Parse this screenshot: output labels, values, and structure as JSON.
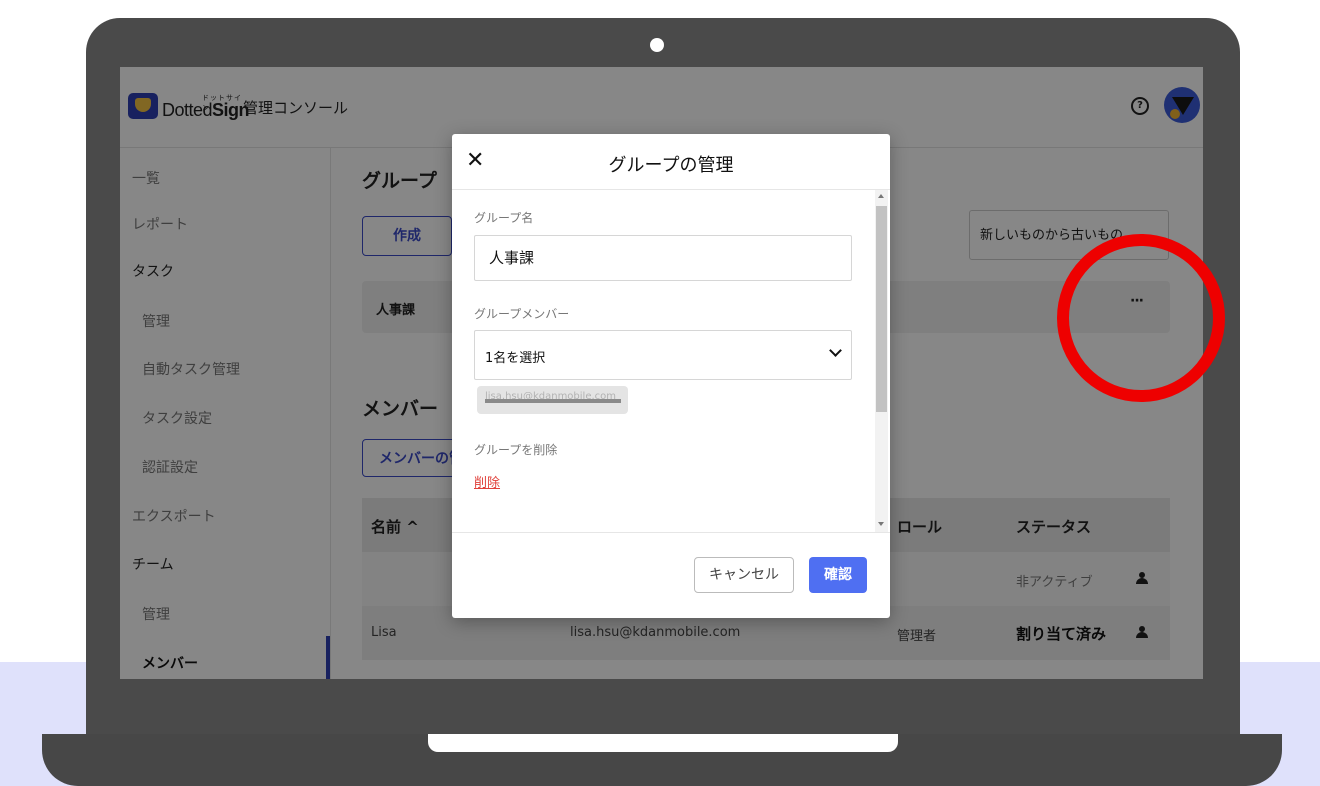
{
  "header": {
    "brand_sup": "ドットサイン",
    "brand_name_a": "Dotted",
    "brand_name_b": "Sign",
    "console_title": "管理コンソール"
  },
  "sidebar": {
    "items": [
      {
        "label": "一覧"
      },
      {
        "label": "レポート"
      },
      {
        "label": "タスク"
      },
      {
        "label": "管理"
      },
      {
        "label": "自動タスク管理"
      },
      {
        "label": "タスク設定"
      },
      {
        "label": "認証設定"
      },
      {
        "label": "エクスポート"
      },
      {
        "label": "チーム"
      },
      {
        "label": "管理"
      },
      {
        "label": "メンバー"
      }
    ]
  },
  "main": {
    "group_heading": "グループ",
    "create_button": "作成",
    "sort_value": "新しいものから古いもの",
    "group_rows": [
      {
        "name": "人事課"
      }
    ],
    "members_heading": "メンバー",
    "manage_members_button": "メンバーの管理",
    "table": {
      "columns": [
        "名前 ^",
        "ロール",
        "ステータス"
      ],
      "rows": [
        {
          "name": "",
          "email": "",
          "role": "",
          "status": "非アクティブ"
        },
        {
          "name": "Lisa",
          "email": "lisa.hsu@kdanmobile.com",
          "role": "管理者",
          "status": "割り当て済み"
        }
      ]
    }
  },
  "modal": {
    "title": "グループの管理",
    "group_name_label": "グループ名",
    "group_name_value": "人事課",
    "members_label": "グループメンバー",
    "members_select_value": "1名を選択",
    "member_chip": "lisa.hsu@kdanmobile.com",
    "delete_group_label": "グループを削除",
    "delete_link": "削除",
    "cancel_button": "キャンセル",
    "confirm_button": "確認"
  },
  "icons": {
    "close": "close-icon",
    "chevron": "chevron-down-icon",
    "help": "help-icon",
    "more": "more-icon",
    "person": "person-icon"
  },
  "colors": {
    "brand_blue": "#2f3fb4",
    "confirm_blue": "#4f6ff2",
    "delete_red": "#e0403a",
    "highlight_red": "#ee0000",
    "backdrop_lavender": "#dfe1fb"
  }
}
